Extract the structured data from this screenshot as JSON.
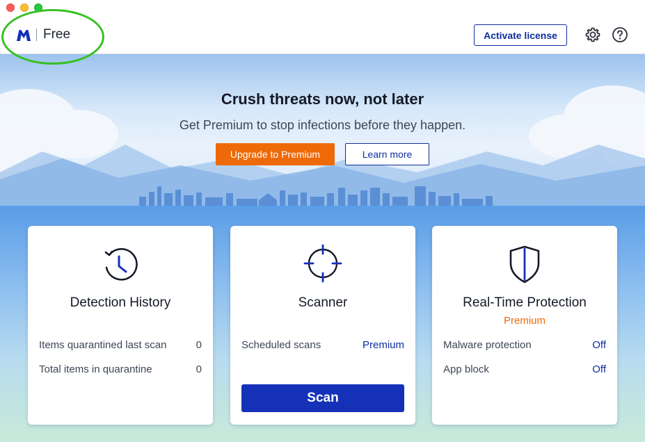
{
  "header": {
    "plan_label": "Free",
    "activate_label": "Activate license",
    "icons": [
      "malwarebytes-logo-icon",
      "gear-icon",
      "help-icon"
    ]
  },
  "hero": {
    "title": "Crush threats now, not later",
    "subtitle": "Get Premium to stop infections before they happen.",
    "upgrade_label": "Upgrade to Premium",
    "learn_label": "Learn more"
  },
  "cards": {
    "detection": {
      "title": "Detection History",
      "icon": "history-clock-icon",
      "rows": [
        {
          "label": "Items quarantined last scan",
          "value": "0"
        },
        {
          "label": "Total items in quarantine",
          "value": "0"
        }
      ]
    },
    "scanner": {
      "title": "Scanner",
      "icon": "crosshair-icon",
      "rows": [
        {
          "label": "Scheduled scans",
          "value": "Premium"
        }
      ],
      "scan_label": "Scan"
    },
    "protection": {
      "title": "Real-Time Protection",
      "subtitle": "Premium",
      "icon": "shield-icon",
      "rows": [
        {
          "label": "Malware protection",
          "value": "Off"
        },
        {
          "label": "App block",
          "value": "Off"
        }
      ]
    }
  },
  "colors": {
    "accent_blue": "#0d2d9e",
    "scan_button": "#1431b8",
    "upgrade_orange": "#ee6a09",
    "annotation_green": "#37c022"
  }
}
